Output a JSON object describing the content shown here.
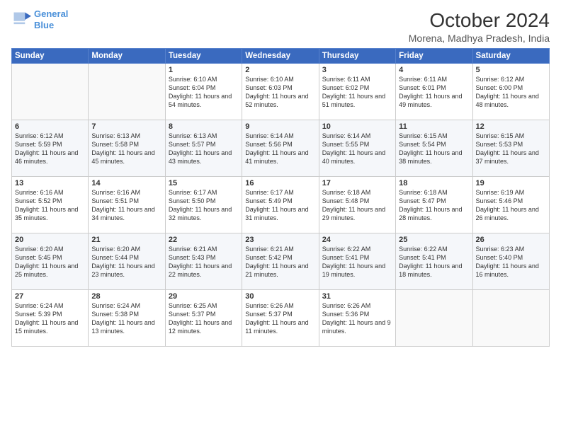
{
  "logo": {
    "line1": "General",
    "line2": "Blue"
  },
  "title": "October 2024",
  "subtitle": "Morena, Madhya Pradesh, India",
  "days_header": [
    "Sunday",
    "Monday",
    "Tuesday",
    "Wednesday",
    "Thursday",
    "Friday",
    "Saturday"
  ],
  "weeks": [
    [
      {
        "day": "",
        "text": ""
      },
      {
        "day": "",
        "text": ""
      },
      {
        "day": "1",
        "text": "Sunrise: 6:10 AM\nSunset: 6:04 PM\nDaylight: 11 hours and 54 minutes."
      },
      {
        "day": "2",
        "text": "Sunrise: 6:10 AM\nSunset: 6:03 PM\nDaylight: 11 hours and 52 minutes."
      },
      {
        "day": "3",
        "text": "Sunrise: 6:11 AM\nSunset: 6:02 PM\nDaylight: 11 hours and 51 minutes."
      },
      {
        "day": "4",
        "text": "Sunrise: 6:11 AM\nSunset: 6:01 PM\nDaylight: 11 hours and 49 minutes."
      },
      {
        "day": "5",
        "text": "Sunrise: 6:12 AM\nSunset: 6:00 PM\nDaylight: 11 hours and 48 minutes."
      }
    ],
    [
      {
        "day": "6",
        "text": "Sunrise: 6:12 AM\nSunset: 5:59 PM\nDaylight: 11 hours and 46 minutes."
      },
      {
        "day": "7",
        "text": "Sunrise: 6:13 AM\nSunset: 5:58 PM\nDaylight: 11 hours and 45 minutes."
      },
      {
        "day": "8",
        "text": "Sunrise: 6:13 AM\nSunset: 5:57 PM\nDaylight: 11 hours and 43 minutes."
      },
      {
        "day": "9",
        "text": "Sunrise: 6:14 AM\nSunset: 5:56 PM\nDaylight: 11 hours and 41 minutes."
      },
      {
        "day": "10",
        "text": "Sunrise: 6:14 AM\nSunset: 5:55 PM\nDaylight: 11 hours and 40 minutes."
      },
      {
        "day": "11",
        "text": "Sunrise: 6:15 AM\nSunset: 5:54 PM\nDaylight: 11 hours and 38 minutes."
      },
      {
        "day": "12",
        "text": "Sunrise: 6:15 AM\nSunset: 5:53 PM\nDaylight: 11 hours and 37 minutes."
      }
    ],
    [
      {
        "day": "13",
        "text": "Sunrise: 6:16 AM\nSunset: 5:52 PM\nDaylight: 11 hours and 35 minutes."
      },
      {
        "day": "14",
        "text": "Sunrise: 6:16 AM\nSunset: 5:51 PM\nDaylight: 11 hours and 34 minutes."
      },
      {
        "day": "15",
        "text": "Sunrise: 6:17 AM\nSunset: 5:50 PM\nDaylight: 11 hours and 32 minutes."
      },
      {
        "day": "16",
        "text": "Sunrise: 6:17 AM\nSunset: 5:49 PM\nDaylight: 11 hours and 31 minutes."
      },
      {
        "day": "17",
        "text": "Sunrise: 6:18 AM\nSunset: 5:48 PM\nDaylight: 11 hours and 29 minutes."
      },
      {
        "day": "18",
        "text": "Sunrise: 6:18 AM\nSunset: 5:47 PM\nDaylight: 11 hours and 28 minutes."
      },
      {
        "day": "19",
        "text": "Sunrise: 6:19 AM\nSunset: 5:46 PM\nDaylight: 11 hours and 26 minutes."
      }
    ],
    [
      {
        "day": "20",
        "text": "Sunrise: 6:20 AM\nSunset: 5:45 PM\nDaylight: 11 hours and 25 minutes."
      },
      {
        "day": "21",
        "text": "Sunrise: 6:20 AM\nSunset: 5:44 PM\nDaylight: 11 hours and 23 minutes."
      },
      {
        "day": "22",
        "text": "Sunrise: 6:21 AM\nSunset: 5:43 PM\nDaylight: 11 hours and 22 minutes."
      },
      {
        "day": "23",
        "text": "Sunrise: 6:21 AM\nSunset: 5:42 PM\nDaylight: 11 hours and 21 minutes."
      },
      {
        "day": "24",
        "text": "Sunrise: 6:22 AM\nSunset: 5:41 PM\nDaylight: 11 hours and 19 minutes."
      },
      {
        "day": "25",
        "text": "Sunrise: 6:22 AM\nSunset: 5:41 PM\nDaylight: 11 hours and 18 minutes."
      },
      {
        "day": "26",
        "text": "Sunrise: 6:23 AM\nSunset: 5:40 PM\nDaylight: 11 hours and 16 minutes."
      }
    ],
    [
      {
        "day": "27",
        "text": "Sunrise: 6:24 AM\nSunset: 5:39 PM\nDaylight: 11 hours and 15 minutes."
      },
      {
        "day": "28",
        "text": "Sunrise: 6:24 AM\nSunset: 5:38 PM\nDaylight: 11 hours and 13 minutes."
      },
      {
        "day": "29",
        "text": "Sunrise: 6:25 AM\nSunset: 5:37 PM\nDaylight: 11 hours and 12 minutes."
      },
      {
        "day": "30",
        "text": "Sunrise: 6:26 AM\nSunset: 5:37 PM\nDaylight: 11 hours and 11 minutes."
      },
      {
        "day": "31",
        "text": "Sunrise: 6:26 AM\nSunset: 5:36 PM\nDaylight: 11 hours and 9 minutes."
      },
      {
        "day": "",
        "text": ""
      },
      {
        "day": "",
        "text": ""
      }
    ]
  ]
}
